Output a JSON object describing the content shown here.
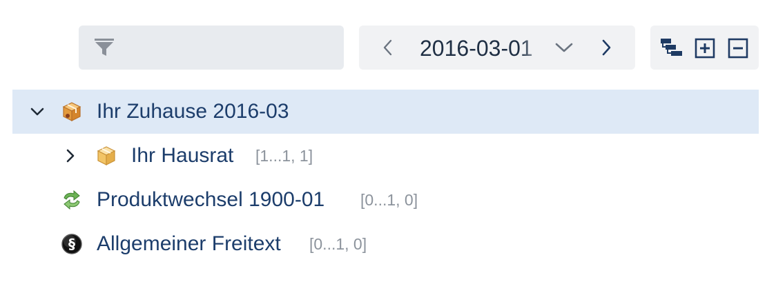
{
  "toolbar": {
    "filter": {
      "icon": "filter-icon",
      "value": "",
      "placeholder": ""
    },
    "date": {
      "prev_icon": "chevron-left-icon",
      "value": "2016-03-01",
      "dropdown_icon": "chevron-down-icon",
      "next_icon": "chevron-right-icon"
    },
    "tree_tools": {
      "icons": [
        "hierarchy-icon",
        "expand-all-icon",
        "collapse-all-icon"
      ]
    }
  },
  "tree": {
    "nodes": [
      {
        "label": "Ihr Zuhause 2016-03",
        "cardinality": "",
        "icon": "package-open-icon",
        "expanded": true,
        "selected": true,
        "level": 0
      },
      {
        "label": "Ihr Hausrat",
        "cardinality": "[1...1, 1]",
        "icon": "package-icon",
        "expanded": false,
        "selected": false,
        "level": 1
      },
      {
        "label": "Produktwechsel 1900-01",
        "cardinality": "[0...1, 0]",
        "icon": "refresh-icon",
        "expanded": null,
        "selected": false,
        "level": 0
      },
      {
        "label": "Allgemeiner Freitext",
        "cardinality": "[0...1, 0]",
        "icon": "section-sign-icon",
        "expanded": null,
        "selected": false,
        "level": 0
      }
    ]
  },
  "colors": {
    "link_text": "#1c3d6b",
    "selected_row": "#dee9f6",
    "muted_text": "#8c939c",
    "icon_dark": "#1e3a63",
    "package_orange": "#e39a3c",
    "refresh_green": "#5ea34a"
  }
}
